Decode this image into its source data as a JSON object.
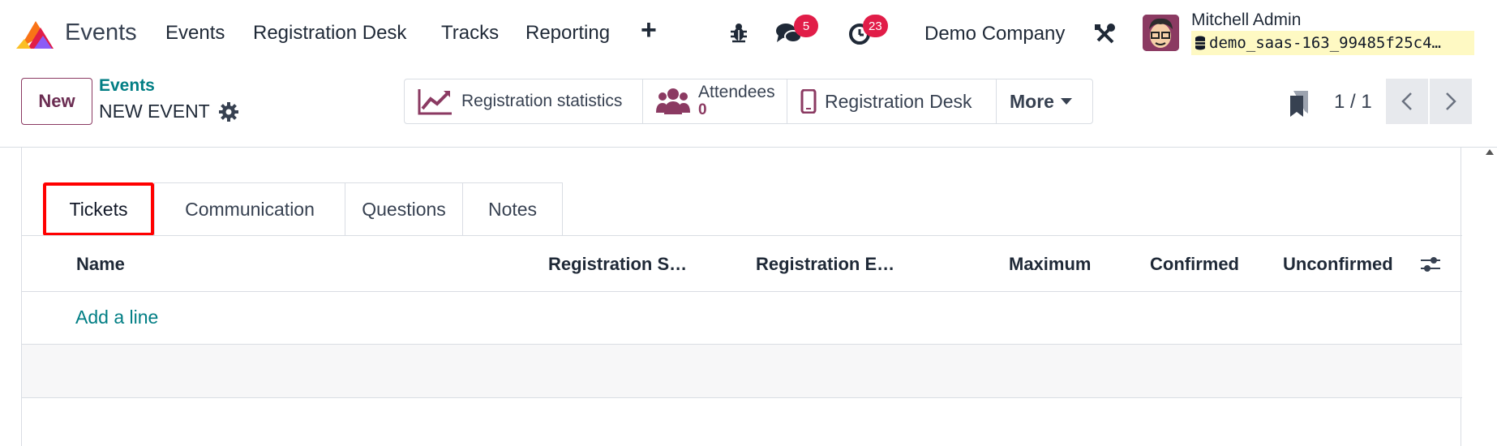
{
  "navbar": {
    "app_name": "Events",
    "menu": [
      "Events",
      "Registration Desk",
      "Tracks",
      "Reporting"
    ],
    "messages_badge": "5",
    "activities_badge": "23",
    "company": "Demo Company",
    "user_name": "Mitchell Admin",
    "database": "demo_saas-163_99485f25c4…"
  },
  "control": {
    "new_label": "New",
    "breadcrumb": "Events",
    "record_title": "NEW EVENT",
    "smart_buttons": {
      "stats": "Registration statistics",
      "attendees": "Attendees",
      "attendees_count": "0",
      "desk": "Registration Desk",
      "more": "More"
    },
    "pager": "1 / 1"
  },
  "tabs": [
    "Tickets",
    "Communication",
    "Questions",
    "Notes"
  ],
  "table": {
    "columns": [
      "Name",
      "Registration S…",
      "Registration E…",
      "Maximum",
      "Confirmed",
      "Unconfirmed"
    ],
    "add_line": "Add a line"
  },
  "colors": {
    "brand": "#8b3a62",
    "link": "#017e84",
    "badge": "#e11d48",
    "highlight": "#ff0000"
  },
  "icons": [
    "odoo-events-logo",
    "plus-icon",
    "bug-icon",
    "chat-icon",
    "clock-icon",
    "tools-icon",
    "database-icon",
    "gear-icon",
    "chart-line-icon",
    "users-icon",
    "mobile-icon",
    "caret-down-icon",
    "bookmark-icon",
    "chevron-left-icon",
    "chevron-right-icon",
    "sliders-icon"
  ]
}
